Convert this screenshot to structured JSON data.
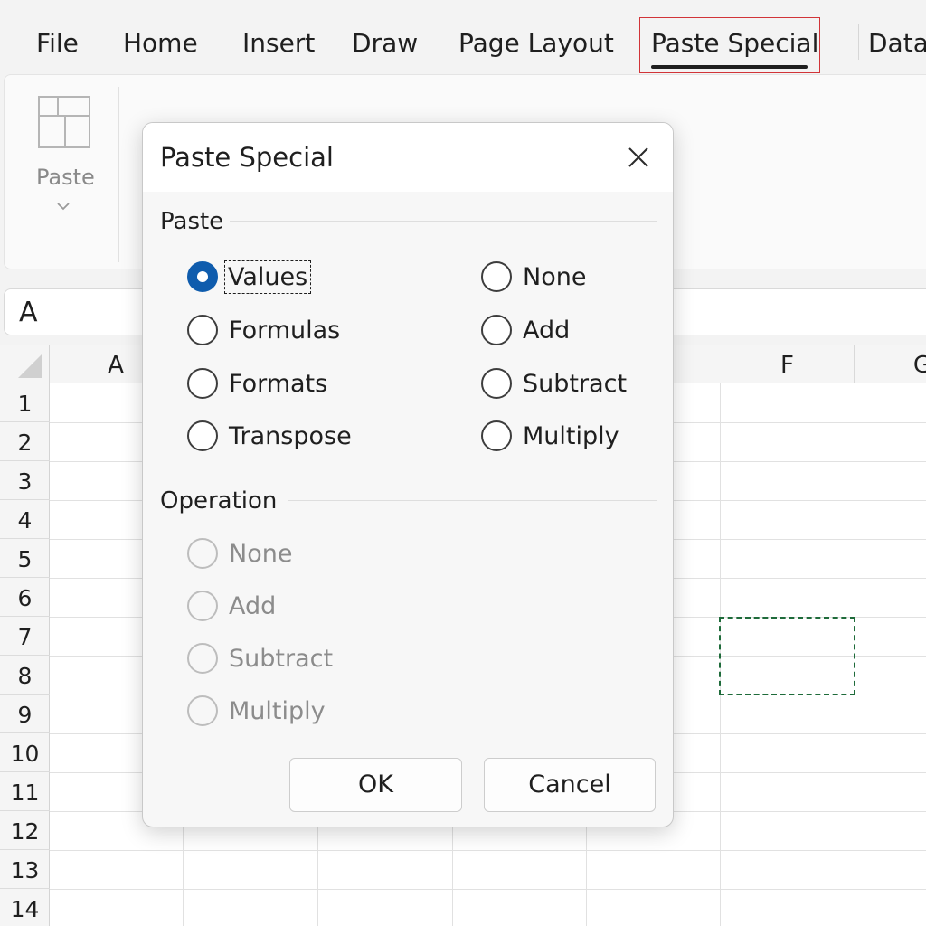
{
  "ribbon": {
    "tabs": [
      {
        "label": "File"
      },
      {
        "label": "Home"
      },
      {
        "label": "Insert"
      },
      {
        "label": "Draw"
      },
      {
        "label": "Page Layout"
      },
      {
        "label": "Paste Special"
      },
      {
        "label": "Data"
      }
    ],
    "active_tab": "Paste Special",
    "paste_button": {
      "label": "Paste",
      "icon": "paste-icon"
    }
  },
  "name_box": {
    "value": "A"
  },
  "grid": {
    "columns": [
      "A",
      "F",
      "G"
    ],
    "rows": [
      "1",
      "2",
      "3",
      "4",
      "5",
      "6",
      "7",
      "8",
      "9",
      "10",
      "11",
      "12",
      "13",
      "14"
    ],
    "copy_marquee_color": "#1e6b3a"
  },
  "dialog": {
    "title": "Paste Special",
    "close_icon": "close-icon",
    "paste_section": {
      "label": "Paste",
      "left_options": [
        {
          "label": "Values",
          "checked": true
        },
        {
          "label": "Formulas",
          "checked": false
        },
        {
          "label": "Formats",
          "checked": false
        },
        {
          "label": "Transpose",
          "checked": false
        }
      ],
      "right_options": [
        {
          "label": "None",
          "checked": false
        },
        {
          "label": "Add",
          "checked": false
        },
        {
          "label": "Subtract",
          "checked": false
        },
        {
          "label": "Multiply",
          "checked": false
        }
      ]
    },
    "operation_section": {
      "label": "Operation",
      "options": [
        {
          "label": "None",
          "disabled": true
        },
        {
          "label": "Add",
          "disabled": true
        },
        {
          "label": "Subtract",
          "disabled": true
        },
        {
          "label": "Multiply",
          "disabled": true
        }
      ]
    },
    "buttons": {
      "ok": "OK",
      "cancel": "Cancel"
    }
  },
  "colors": {
    "accent": "#0f5cad",
    "active_tab_border": "#d13438"
  }
}
